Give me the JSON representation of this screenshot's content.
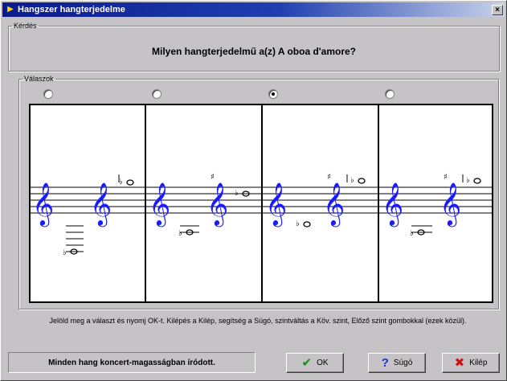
{
  "window": {
    "title": "Hangszer hangterjedelme",
    "close_glyph": "×"
  },
  "question_group": {
    "legend": "Kérdés",
    "question": "Milyen hangterjedelmű a(z) A oboa d'amore?"
  },
  "answers_group": {
    "legend": "Válaszok",
    "options": [
      {
        "selected": false
      },
      {
        "selected": false
      },
      {
        "selected": true
      },
      {
        "selected": false
      }
    ]
  },
  "hint": "Jelöld meg a választ és nyomj OK-t. Kilépés a Kilép, segítség a Súgó, szintváltás a Köv. szint, Előző szint gombokkal (ezek közül).",
  "status": "Minden hang koncert-magasságban íródott.",
  "buttons": {
    "ok": {
      "label": "OK",
      "icon": "checkmark-icon",
      "color": "#1a8a1a"
    },
    "help": {
      "label": "Súgó",
      "icon": "question-icon",
      "color": "#1636c8"
    },
    "exit": {
      "label": "Kilép",
      "icon": "x-icon",
      "color": "#d01010"
    }
  },
  "colors": {
    "clef": "#1a1aff",
    "title_start": "#0b1b8e",
    "face": "#c6c3c6"
  },
  "symbols": {
    "treble_clef": "𝄞",
    "flat": "♭",
    "sharp": "♯"
  }
}
